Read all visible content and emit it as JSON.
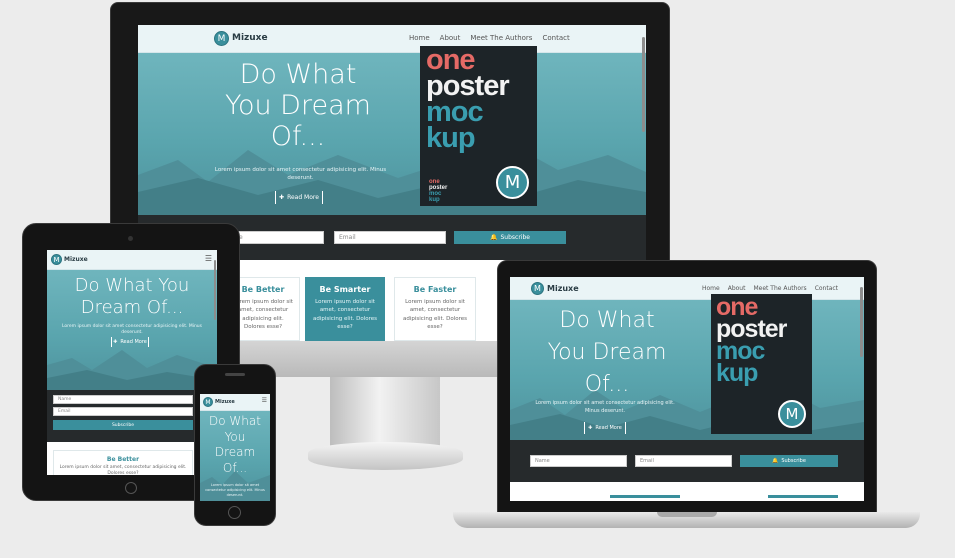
{
  "site": {
    "brand": "Mizuxe",
    "logo_letter": "M",
    "nav": [
      "Home",
      "About",
      "Meet The Authors",
      "Contact"
    ],
    "hero_title": "Do What You Dream Of...",
    "hero_title_lines_3": [
      "Do What",
      "You Dream",
      "Of..."
    ],
    "hero_title_lines_2": [
      "Do What You",
      "Dream Of..."
    ],
    "hero_title_lines_4": [
      "Do What",
      "You",
      "Dream",
      "Of..."
    ],
    "hero_text": "Lorem ipsum dolor sit amet consectetur adipisicing elit. Minus deserunt.",
    "read_more": "Read More",
    "name_placeholder": "Name",
    "email_placeholder": "Email",
    "subscribe": "Subscribe",
    "poster_lines": [
      "one",
      "poster",
      "moc",
      "kup"
    ],
    "cards": [
      {
        "title": "Be Better",
        "body": "Lorem ipsum dolor sit amet, consectetur adipisicing elit. Dolores esse?"
      },
      {
        "title": "Be Smarter",
        "body": "Lorem ipsum dolor sit amet, consectetur adipisicing elit. Dolores esse?"
      },
      {
        "title": "Be Faster",
        "body": "Lorem ipsum dolor sit amet, consectetur adipisicing elit. Dolores esse?"
      }
    ]
  },
  "colors": {
    "accent": "#3a8f9c",
    "hero_top": "#6fb5bd",
    "subscribe_bar": "#262a2c",
    "poster_red": "#e56a66",
    "poster_white": "#f2f2f2",
    "poster_teal": "#3a9eb0"
  }
}
